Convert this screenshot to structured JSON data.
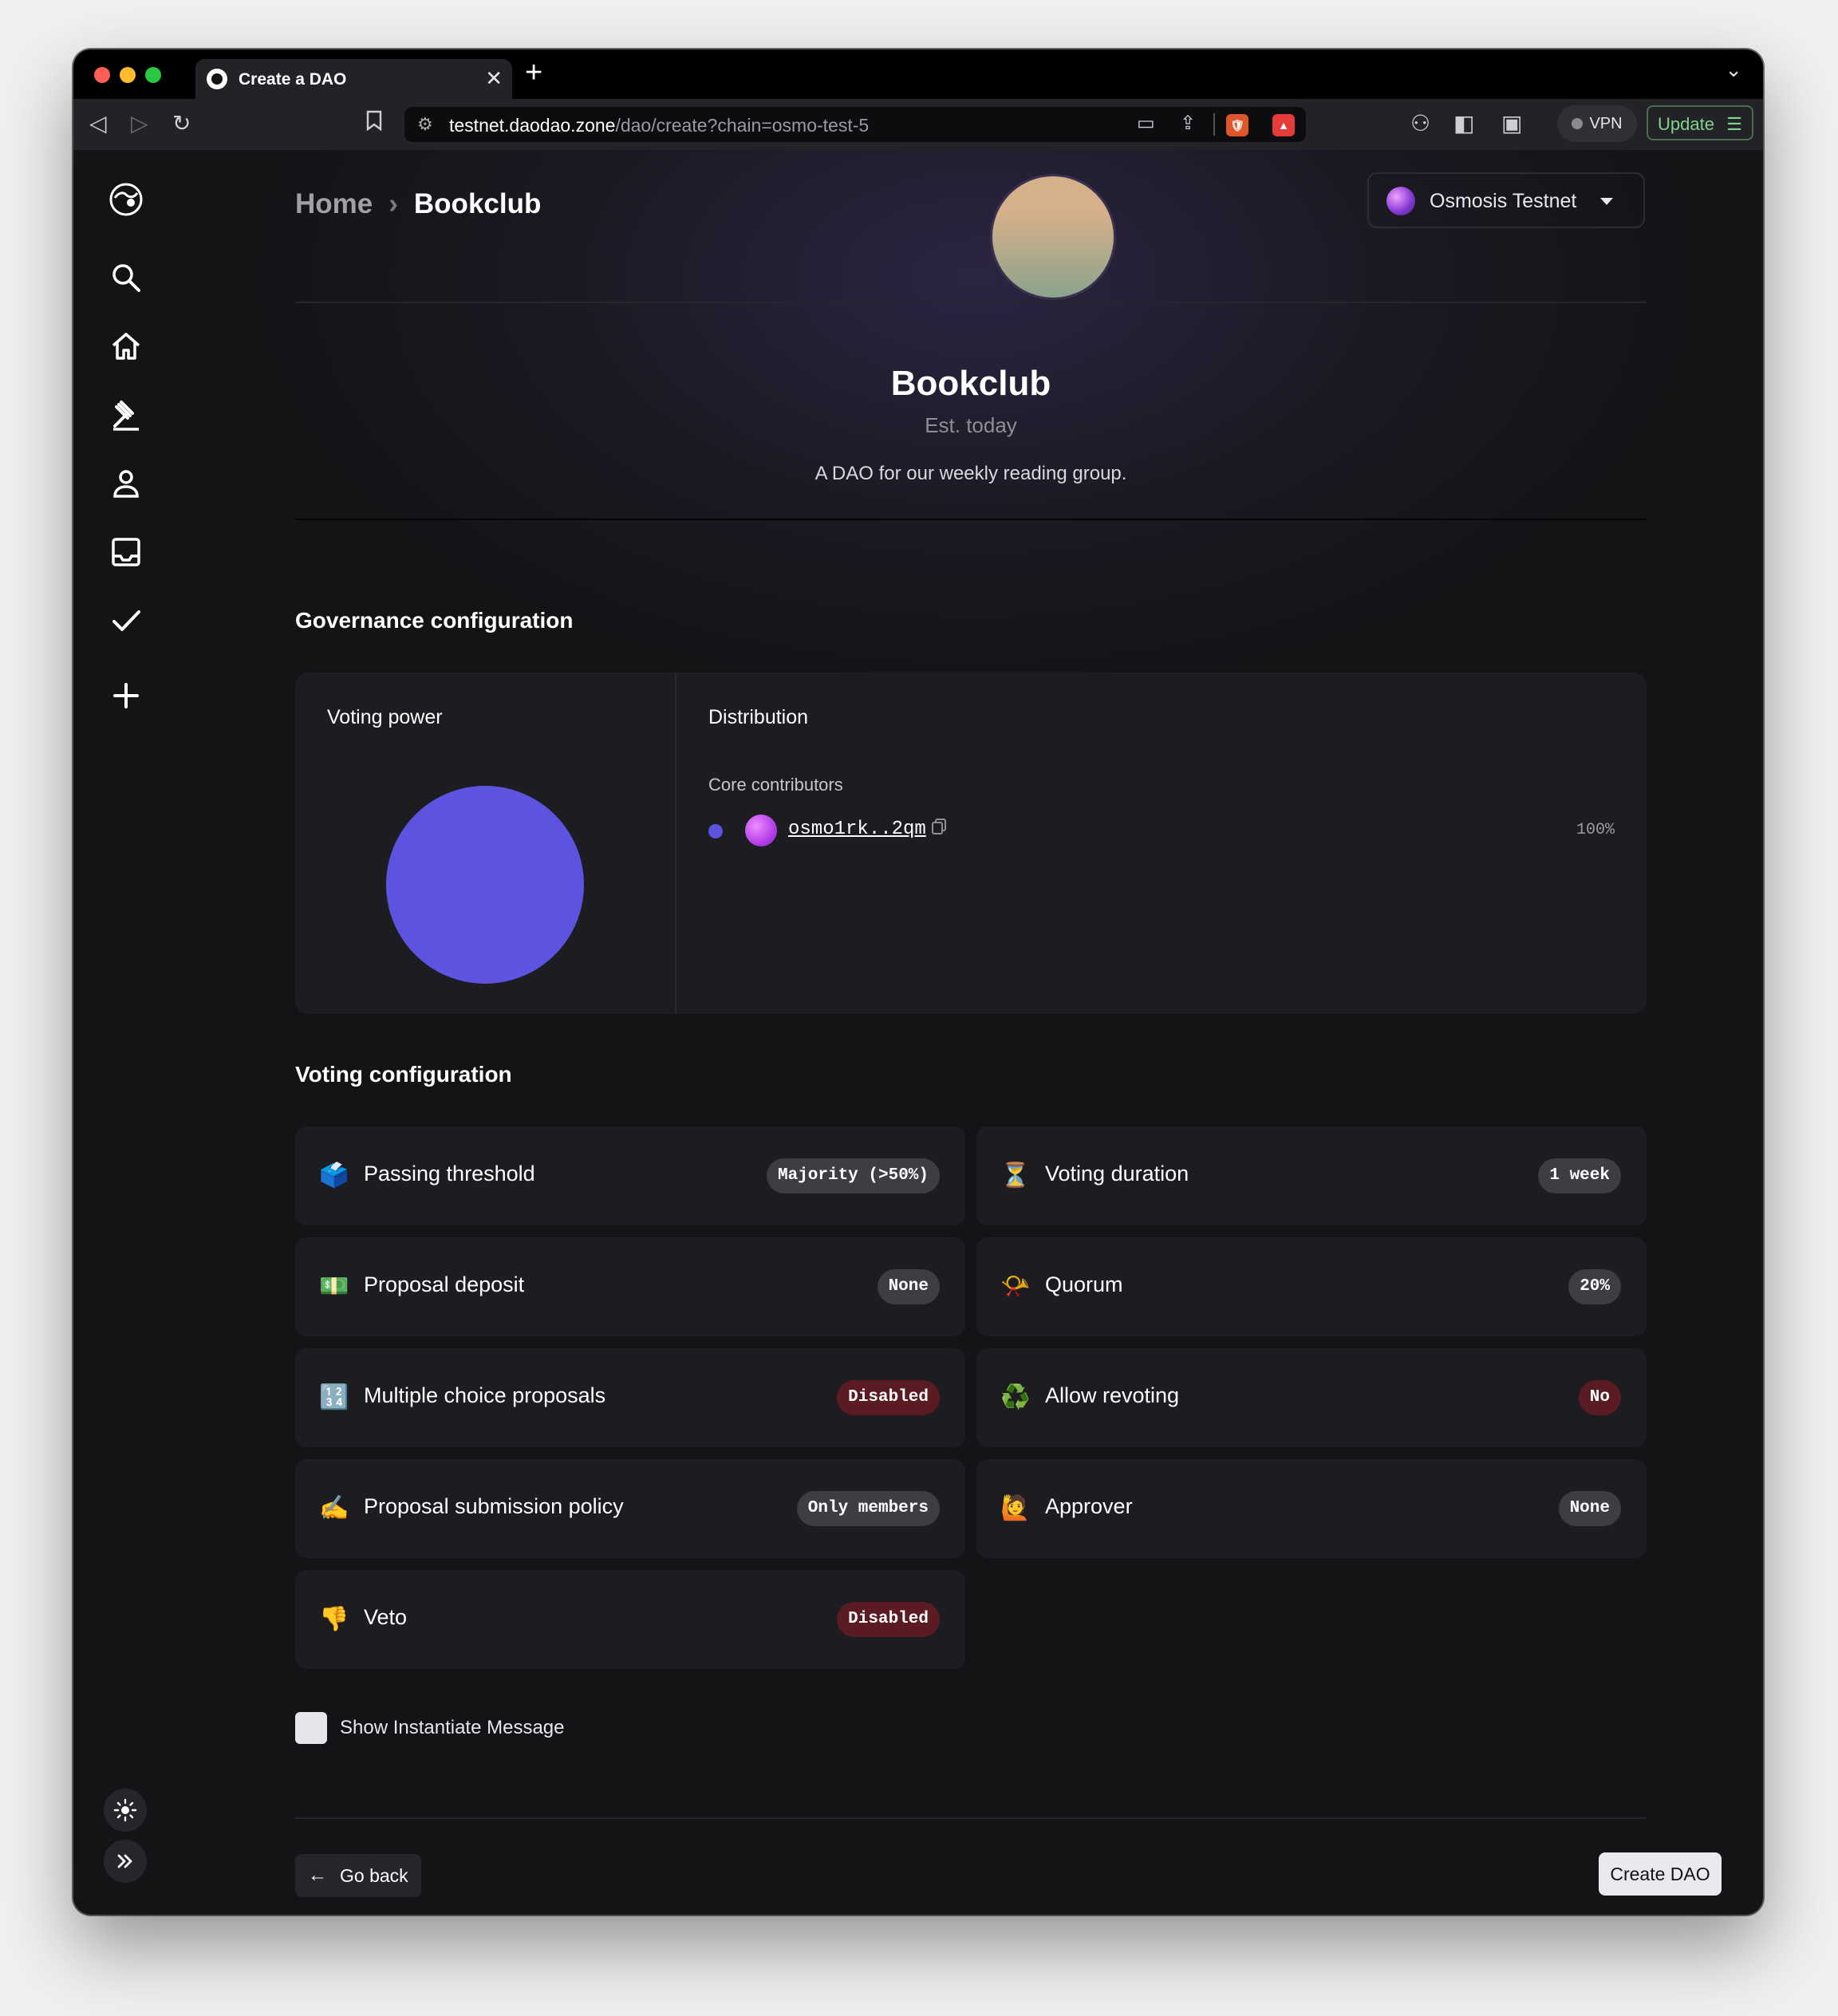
{
  "browser": {
    "tab_title": "Create a DAO",
    "url_domain": "testnet.daodao.zone",
    "url_path": "/dao/create?chain=osmo-test-5",
    "vpn_label": "VPN",
    "update_label": "Update",
    "brave_shield_count": "1",
    "rewards_count": "1"
  },
  "header": {
    "breadcrumb_home": "Home",
    "breadcrumb_current": "Bookclub",
    "chain_name": "Osmosis Testnet"
  },
  "dao": {
    "name": "Bookclub",
    "established": "Est. today",
    "description": "A DAO for our weekly reading group."
  },
  "governance": {
    "section_title": "Governance configuration",
    "voting_power_title": "Voting power",
    "distribution_title": "Distribution",
    "tier_name": "Core contributors",
    "member_address": "osmo1rk..2qm",
    "member_percent": "100%",
    "pie_color": "#5c54e0"
  },
  "voting": {
    "section_title": "Voting configuration",
    "items": [
      {
        "icon": "ballot-box-icon",
        "emoji": "🗳️",
        "label": "Passing threshold",
        "value": "Majority (>50%)",
        "tone": "neutral"
      },
      {
        "icon": "hourglass-icon",
        "emoji": "⏳",
        "label": "Voting duration",
        "value": "1 week",
        "tone": "neutral"
      },
      {
        "icon": "money-icon",
        "emoji": "💵",
        "label": "Proposal deposit",
        "value": "None",
        "tone": "neutral"
      },
      {
        "icon": "megaphone-icon",
        "emoji": "📯",
        "label": "Quorum",
        "value": "20%",
        "tone": "neutral"
      },
      {
        "icon": "numbers-icon",
        "emoji": "🔢",
        "label": "Multiple choice proposals",
        "value": "Disabled",
        "tone": "red"
      },
      {
        "icon": "recycle-icon",
        "emoji": "♻️",
        "label": "Allow revoting",
        "value": "No",
        "tone": "red"
      },
      {
        "icon": "pen-icon",
        "emoji": "✍️",
        "label": "Proposal submission policy",
        "value": "Only members",
        "tone": "neutral"
      },
      {
        "icon": "person-raising-hand-icon",
        "emoji": "🙋",
        "label": "Approver",
        "value": "None",
        "tone": "neutral"
      },
      {
        "icon": "thumbs-down-icon",
        "emoji": "👎",
        "label": "Veto",
        "value": "Disabled",
        "tone": "red"
      }
    ]
  },
  "footer": {
    "show_instantiate_label": "Show Instantiate Message",
    "go_back_label": "Go back",
    "create_label": "Create DAO"
  },
  "colors": {
    "accent": "#5c54e0",
    "background": "#141417",
    "card": "#1d1d21",
    "badge_red": "#5a1c22"
  }
}
